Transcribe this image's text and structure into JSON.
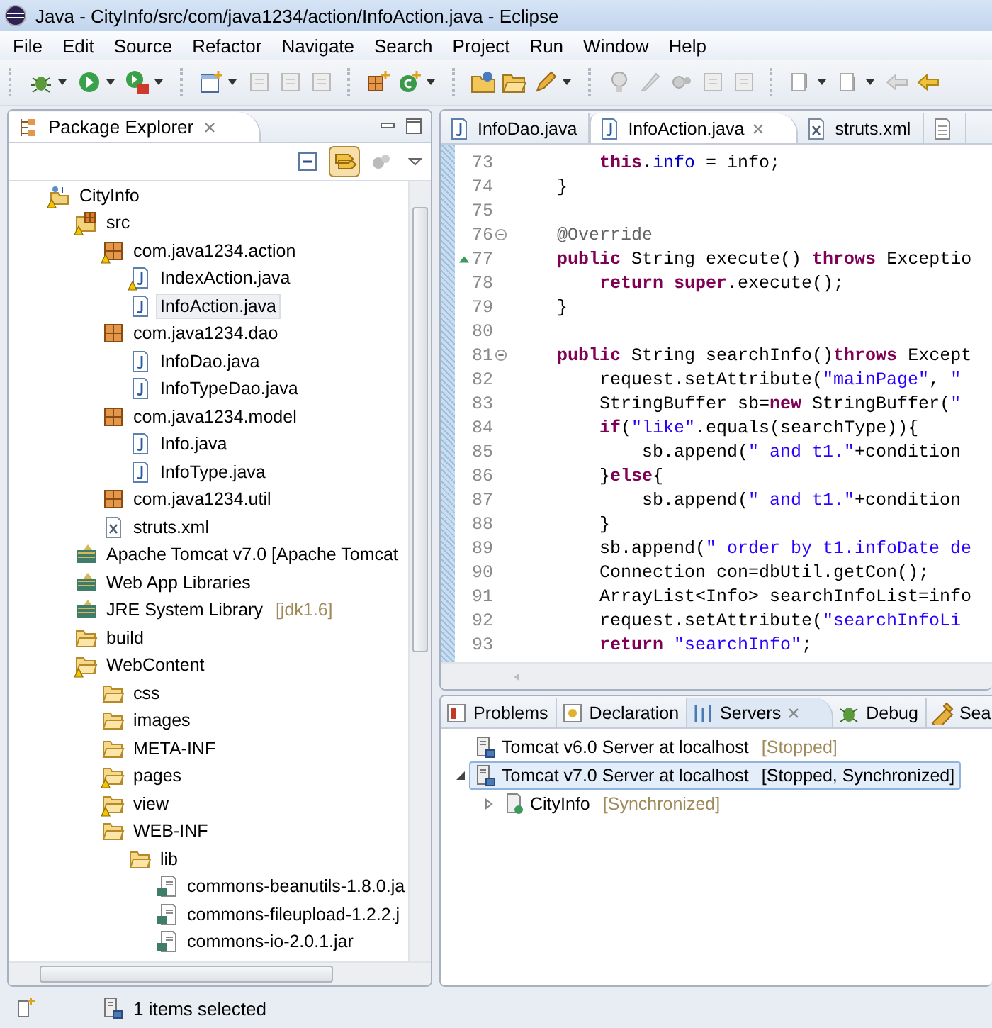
{
  "window": {
    "title": "Java - CityInfo/src/com/java1234/action/InfoAction.java - Eclipse"
  },
  "menu": [
    "File",
    "Edit",
    "Source",
    "Refactor",
    "Navigate",
    "Search",
    "Project",
    "Run",
    "Window",
    "Help"
  ],
  "package_explorer": {
    "title": "Package Explorer",
    "link_with_editor": true,
    "tree": [
      {
        "label": "CityInfo",
        "kind": "project",
        "warning": true,
        "selected": false,
        "children": [
          {
            "label": "src",
            "kind": "srcfolder",
            "warning": true,
            "selected": false,
            "children": [
              {
                "label": "com.java1234.action",
                "kind": "package",
                "warning": true,
                "selected": false,
                "children": [
                  {
                    "label": "IndexAction.java",
                    "kind": "java",
                    "warning": true,
                    "selected": false
                  },
                  {
                    "label": "InfoAction.java",
                    "kind": "java",
                    "warning": false,
                    "selected": true
                  }
                ]
              },
              {
                "label": "com.java1234.dao",
                "kind": "package",
                "warning": false,
                "selected": false,
                "children": [
                  {
                    "label": "InfoDao.java",
                    "kind": "java",
                    "warning": false,
                    "selected": false
                  },
                  {
                    "label": "InfoTypeDao.java",
                    "kind": "java",
                    "warning": false,
                    "selected": false
                  }
                ]
              },
              {
                "label": "com.java1234.model",
                "kind": "package",
                "warning": false,
                "selected": false,
                "children": [
                  {
                    "label": "Info.java",
                    "kind": "java",
                    "warning": false,
                    "selected": false
                  },
                  {
                    "label": "InfoType.java",
                    "kind": "java",
                    "warning": false,
                    "selected": false
                  }
                ]
              },
              {
                "label": "com.java1234.util",
                "kind": "package",
                "warning": false,
                "selected": false
              },
              {
                "label": "struts.xml",
                "kind": "xml",
                "warning": false,
                "selected": false
              }
            ]
          },
          {
            "label": "Apache Tomcat v7.0 [Apache Tomcat",
            "kind": "library",
            "warning": false,
            "selected": false
          },
          {
            "label": "Web App Libraries",
            "kind": "library",
            "warning": false,
            "selected": false
          },
          {
            "label": "JRE System Library",
            "suffix": "[jdk1.6]",
            "kind": "library",
            "warning": false,
            "selected": false
          },
          {
            "label": "build",
            "kind": "folder",
            "warning": false,
            "selected": false
          },
          {
            "label": "WebContent",
            "kind": "folder",
            "warning": true,
            "selected": false,
            "children": [
              {
                "label": "css",
                "kind": "folder",
                "warning": false,
                "selected": false
              },
              {
                "label": "images",
                "kind": "folder",
                "warning": false,
                "selected": false
              },
              {
                "label": "META-INF",
                "kind": "folder",
                "warning": false,
                "selected": false
              },
              {
                "label": "pages",
                "kind": "folder",
                "warning": true,
                "selected": false
              },
              {
                "label": "view",
                "kind": "folder",
                "warning": true,
                "selected": false
              },
              {
                "label": "WEB-INF",
                "kind": "folder",
                "warning": false,
                "selected": false,
                "children": [
                  {
                    "label": "lib",
                    "kind": "folder",
                    "warning": false,
                    "selected": false,
                    "children": [
                      {
                        "label": "commons-beanutils-1.8.0.ja",
                        "kind": "jar",
                        "warning": false,
                        "selected": false
                      },
                      {
                        "label": "commons-fileupload-1.2.2.j",
                        "kind": "jar",
                        "warning": false,
                        "selected": false
                      },
                      {
                        "label": "commons-io-2.0.1.jar",
                        "kind": "jar",
                        "warning": false,
                        "selected": false
                      }
                    ]
                  }
                ]
              }
            ]
          }
        ]
      }
    ]
  },
  "editor": {
    "tabs": [
      {
        "label": "InfoDao.java",
        "kind": "java",
        "selected": false
      },
      {
        "label": "InfoAction.java",
        "kind": "java",
        "selected": true
      },
      {
        "label": "struts.xml",
        "kind": "xml",
        "selected": false
      },
      {
        "kind": "other",
        "selected": false
      }
    ],
    "lines": [
      {
        "number": "73",
        "fold": false,
        "override": false,
        "segments": [
          {
            "kind": "kw",
            "text": "    this"
          },
          {
            "kind": "plain",
            "text": "."
          },
          {
            "kind": "field",
            "text": "info"
          },
          {
            "kind": "plain",
            "text": " = info;"
          }
        ]
      },
      {
        "number": "74",
        "fold": false,
        "override": false,
        "segments": [
          {
            "kind": "plain",
            "text": "}"
          }
        ]
      },
      {
        "number": "75",
        "fold": false,
        "override": false
      },
      {
        "number": "76",
        "fold": true,
        "override": false,
        "segments": [
          {
            "kind": "ann",
            "text": "@Override"
          }
        ]
      },
      {
        "number": "77",
        "fold": false,
        "override": true,
        "segments": [
          {
            "kind": "kw",
            "text": "public"
          },
          {
            "kind": "plain",
            "text": " String execute() "
          },
          {
            "kind": "kw",
            "text": "throws"
          },
          {
            "kind": "plain",
            "text": " Exceptio"
          }
        ]
      },
      {
        "number": "78",
        "fold": false,
        "override": false,
        "segments": [
          {
            "kind": "kw",
            "text": "    return super"
          },
          {
            "kind": "plain",
            "text": ".execute();"
          }
        ]
      },
      {
        "number": "79",
        "fold": false,
        "override": false,
        "segments": [
          {
            "kind": "plain",
            "text": "}"
          }
        ]
      },
      {
        "number": "80",
        "fold": false,
        "override": false
      },
      {
        "number": "81",
        "fold": true,
        "override": false,
        "segments": [
          {
            "kind": "kw",
            "text": "public"
          },
          {
            "kind": "plain",
            "text": " String searchInfo()"
          },
          {
            "kind": "kw",
            "text": "throws"
          },
          {
            "kind": "plain",
            "text": " Except"
          }
        ]
      },
      {
        "number": "82",
        "fold": false,
        "override": false,
        "segments": [
          {
            "kind": "plain",
            "text": "    request.setAttribute("
          },
          {
            "kind": "str",
            "text": "\"mainPage\""
          },
          {
            "kind": "plain",
            "text": ", "
          },
          {
            "kind": "str",
            "text": "\""
          }
        ]
      },
      {
        "number": "83",
        "fold": false,
        "override": false,
        "segments": [
          {
            "kind": "plain",
            "text": "    StringBuffer sb="
          },
          {
            "kind": "kw",
            "text": "new"
          },
          {
            "kind": "plain",
            "text": " StringBuffer("
          },
          {
            "kind": "str",
            "text": "\""
          }
        ]
      },
      {
        "number": "84",
        "fold": false,
        "override": false,
        "segments": [
          {
            "kind": "kw",
            "text": "    if"
          },
          {
            "kind": "plain",
            "text": "("
          },
          {
            "kind": "str",
            "text": "\"like\""
          },
          {
            "kind": "plain",
            "text": ".equals(searchType)){"
          }
        ]
      },
      {
        "number": "85",
        "fold": false,
        "override": false,
        "segments": [
          {
            "kind": "plain",
            "text": "        sb.append("
          },
          {
            "kind": "str",
            "text": "\" and t1.\""
          },
          {
            "kind": "plain",
            "text": "+condition"
          }
        ]
      },
      {
        "number": "86",
        "fold": false,
        "override": false,
        "segments": [
          {
            "kind": "plain",
            "text": "    }"
          },
          {
            "kind": "kw",
            "text": "else"
          },
          {
            "kind": "plain",
            "text": "{"
          }
        ]
      },
      {
        "number": "87",
        "fold": false,
        "override": false,
        "segments": [
          {
            "kind": "plain",
            "text": "        sb.append("
          },
          {
            "kind": "str",
            "text": "\" and t1.\""
          },
          {
            "kind": "plain",
            "text": "+condition"
          }
        ]
      },
      {
        "number": "88",
        "fold": false,
        "override": false,
        "segments": [
          {
            "kind": "plain",
            "text": "    }"
          }
        ]
      },
      {
        "number": "89",
        "fold": false,
        "override": false,
        "segments": [
          {
            "kind": "plain",
            "text": "    sb.append("
          },
          {
            "kind": "str",
            "text": "\" order by t1.infoDate de"
          }
        ]
      },
      {
        "number": "90",
        "fold": false,
        "override": false,
        "segments": [
          {
            "kind": "plain",
            "text": "    Connection con=dbUtil.getCon();"
          }
        ]
      },
      {
        "number": "91",
        "fold": false,
        "override": false,
        "segments": [
          {
            "kind": "plain",
            "text": "    ArrayList<Info> searchInfoList=info"
          }
        ]
      },
      {
        "number": "92",
        "fold": false,
        "override": false,
        "segments": [
          {
            "kind": "plain",
            "text": "    request.setAttribute("
          },
          {
            "kind": "str",
            "text": "\"searchInfoLi"
          }
        ]
      },
      {
        "number": "93",
        "fold": false,
        "override": false,
        "segments": [
          {
            "kind": "kw",
            "text": "    return"
          },
          {
            "kind": "str",
            "text": " \"searchInfo\""
          },
          {
            "kind": "plain",
            "text": ";"
          }
        ]
      }
    ]
  },
  "bottom_panel": {
    "tabs": [
      {
        "label": "Problems",
        "kind": "problems",
        "selected": false
      },
      {
        "label": "Declaration",
        "kind": "declaration",
        "selected": false
      },
      {
        "label": "Servers",
        "kind": "servers",
        "selected": true
      },
      {
        "label": "Debug",
        "kind": "debug",
        "selected": false
      },
      {
        "label": "Sea",
        "kind": "search",
        "selected": false
      }
    ],
    "servers": [
      {
        "label": "Tomcat v6.0 Server at localhost",
        "status": "[Stopped]",
        "kind": "server",
        "selected": false
      },
      {
        "label": "Tomcat v7.0 Server at localhost",
        "status": "[Stopped, Synchronized]",
        "kind": "server",
        "selected": true,
        "expanded": true,
        "children": [
          {
            "label": "CityInfo",
            "status": "[Synchronized]",
            "kind": "module",
            "selected": false,
            "expanded": false
          }
        ]
      }
    ]
  },
  "status_bar": {
    "text": "1 items selected"
  }
}
